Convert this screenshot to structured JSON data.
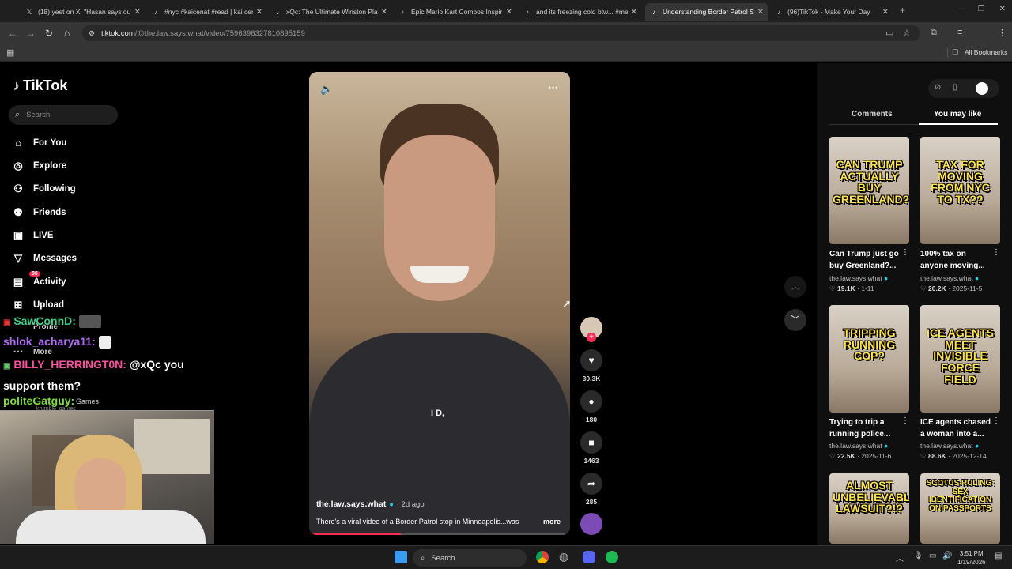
{
  "browser": {
    "tabs": [
      {
        "title": "(18) yeet on X: \"Hasan says out",
        "icon": "x-logo-icon"
      },
      {
        "title": "#nyc #kaicenat #read | kai cena",
        "icon": "tiktok-icon"
      },
      {
        "title": "xQc: The Ultimate Winston Play",
        "icon": "tiktok-icon"
      },
      {
        "title": "Epic Mario Kart Combos Inspir",
        "icon": "tiktok-icon"
      },
      {
        "title": "and its freezing cold btw... #me",
        "icon": "tiktok-icon"
      },
      {
        "title": "Understanding Border Patrol St",
        "icon": "tiktok-icon"
      },
      {
        "title": "(96)TikTok - Make Your Day",
        "icon": "tiktok-icon"
      }
    ],
    "url_host": "tiktok.com",
    "url_path": "/@the.law.says.what/video/7596396327810895159",
    "bookmarks_label": "All Bookmarks"
  },
  "tiktok": {
    "logo": "TikTok",
    "search_placeholder": "Search",
    "nav": [
      {
        "label": "For You",
        "icon": "home-icon"
      },
      {
        "label": "Explore",
        "icon": "compass-icon"
      },
      {
        "label": "Following",
        "icon": "following-icon"
      },
      {
        "label": "Friends",
        "icon": "friends-icon"
      },
      {
        "label": "LIVE",
        "icon": "live-icon"
      },
      {
        "label": "Messages",
        "icon": "messages-icon"
      },
      {
        "label": "Activity",
        "icon": "activity-icon",
        "badge": "96"
      },
      {
        "label": "Upload",
        "icon": "upload-icon"
      },
      {
        "label": "Profile",
        "icon": "profile-icon"
      },
      {
        "label": "More",
        "icon": "more-icon"
      }
    ],
    "behind_text": "Games",
    "behind_sub": "krumble_games"
  },
  "chat": [
    {
      "user": "SawConnD:",
      "msg": "",
      "color": "#44d08c"
    },
    {
      "user": "shlok_acharya11:",
      "msg": "",
      "color": "#b06cf5"
    },
    {
      "user": "BILLY_HERRINGT0N:",
      "msg": "@xQc you support them?",
      "color": "#ff4fa0"
    },
    {
      "user": "politeGatguy:",
      "msg": "",
      "color": "#7fdc3c"
    }
  ],
  "video": {
    "caption_overlay": "I D,",
    "author": "the.law.says.what",
    "posted": "· 2d ago",
    "description": "There's a viral video of a Border Patrol stop in Minneapolis...was",
    "more": "more",
    "progress": 0.35
  },
  "actions": {
    "likes": "30.3K",
    "comments": "180",
    "saves": "1463",
    "shares": "285"
  },
  "panel": {
    "tabs": [
      "Comments",
      "You may like"
    ],
    "active_tab": "You may like",
    "videos": [
      {
        "cap": "CAN TRUMP ACTUALLY BUY GREENLAND?",
        "title": "Can Trump just go buy Greenland?...",
        "author": "the.law.says.what",
        "likes": "19.1K",
        "date": "1-11"
      },
      {
        "cap": "TAX FOR MOVING FROM NYC TO TX??",
        "title": "100% tax on anyone moving...",
        "author": "the.law.says.what",
        "likes": "20.2K",
        "date": "2025-11-5"
      },
      {
        "cap": "TRIPPING RUNNING COP?",
        "title": "Trying to trip a running police...",
        "author": "the.law.says.what",
        "likes": "22.5K",
        "date": "2025-11-6"
      },
      {
        "cap": "ICE AGENTS MEET INVISIBLE FORCE FIELD",
        "title": "ICE agents chased a woman into a...",
        "author": "the.law.says.what",
        "likes": "88.6K",
        "date": "2025-12-14"
      },
      {
        "cap": "ALMOST UNBELIEVABLE LAWSUIT?!?",
        "title": "",
        "author": "",
        "likes": "",
        "date": ""
      },
      {
        "cap": "SCOTUS RULING: SEX IDENTIFICATION ON PASSPORTS",
        "title": "",
        "author": "",
        "likes": "",
        "date": ""
      }
    ]
  },
  "taskbar": {
    "search": "Search",
    "time": "3:51 PM",
    "date": "1/19/2026"
  }
}
